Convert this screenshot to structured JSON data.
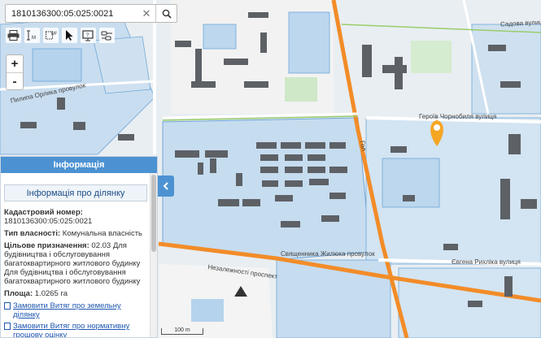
{
  "search": {
    "value": "1810136300:05:025:0021",
    "clear_symbol": "✕"
  },
  "zoom": {
    "in_label": "+",
    "out_label": "-"
  },
  "panel": {
    "title": "Інформація",
    "subtitle": "Інформація про ділянку",
    "cadastral_label": "Кадастровий номер:",
    "cadastral_value": "1810136300:05:025:0021",
    "ownership_label": "Тип власності:",
    "ownership_value": "Комунальна власність",
    "purpose_label": "Цільове призначення:",
    "purpose_value": "02.03 Для будівництва і обслуговування багатоквартирного житлового будинку",
    "purpose_extra": "Для будівництва і обслуговування багатоквартирного житлового будинку",
    "area_label": "Площа:",
    "area_value": "1.0265 га",
    "link_1": "Замовити Витяг про земельну ділянку",
    "link_2": "Замовити Витяг про нормативну грошову оцінку"
  },
  "map": {
    "streets": {
      "chornobyl": "Героїв Чорнобиля вулиця",
      "sadova": "Садова вулиця",
      "pylypa_orlyka": "Пилипа Орлика провулок",
      "sviashchennyka": "Священника Жилюка провулок",
      "yevhena_rykhlika": "Євгена Рихліка вулиця",
      "nezalezhnosti": "Незалежності проспект",
      "short_label": "Гол"
    },
    "scale_label": "100 m",
    "marker_color": "#f5a623",
    "parcel_fill": "#bcd7ee",
    "road_color": "#f28c28"
  }
}
